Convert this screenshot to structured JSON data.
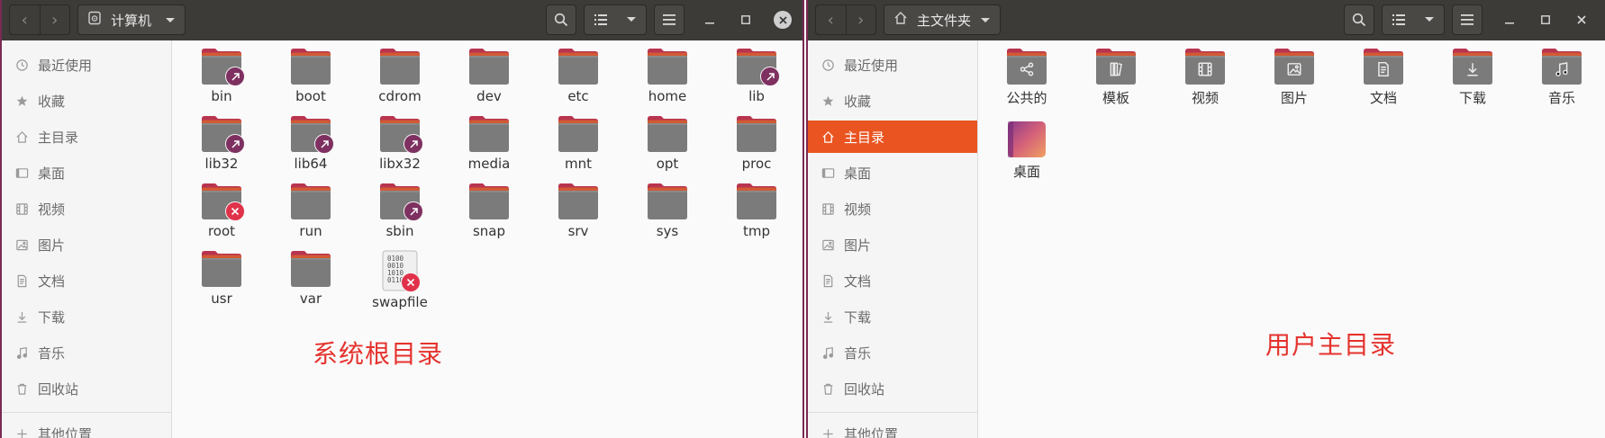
{
  "left_window": {
    "location": "计算机",
    "sidebar": {
      "items": [
        {
          "label": "最近使用",
          "icon": "clock-icon"
        },
        {
          "label": "收藏",
          "icon": "star-icon"
        },
        {
          "label": "主目录",
          "icon": "home-icon"
        },
        {
          "label": "桌面",
          "icon": "desktop-icon"
        },
        {
          "label": "视频",
          "icon": "video-icon"
        },
        {
          "label": "图片",
          "icon": "image-icon"
        },
        {
          "label": "文档",
          "icon": "document-icon"
        },
        {
          "label": "下载",
          "icon": "download-icon"
        },
        {
          "label": "音乐",
          "icon": "music-icon"
        },
        {
          "label": "回收站",
          "icon": "trash-icon"
        }
      ],
      "other": {
        "label": "其他位置",
        "icon": "plus-icon"
      }
    },
    "items": [
      {
        "name": "bin",
        "emblem": "link"
      },
      {
        "name": "boot",
        "emblem": ""
      },
      {
        "name": "cdrom",
        "emblem": ""
      },
      {
        "name": "dev",
        "emblem": ""
      },
      {
        "name": "etc",
        "emblem": ""
      },
      {
        "name": "home",
        "emblem": ""
      },
      {
        "name": "lib",
        "emblem": "link"
      },
      {
        "name": "lib32",
        "emblem": "link"
      },
      {
        "name": "lib64",
        "emblem": "link"
      },
      {
        "name": "libx32",
        "emblem": "link"
      },
      {
        "name": "media",
        "emblem": ""
      },
      {
        "name": "mnt",
        "emblem": ""
      },
      {
        "name": "opt",
        "emblem": ""
      },
      {
        "name": "proc",
        "emblem": ""
      },
      {
        "name": "root",
        "emblem": "noaccess"
      },
      {
        "name": "run",
        "emblem": ""
      },
      {
        "name": "sbin",
        "emblem": "link"
      },
      {
        "name": "snap",
        "emblem": ""
      },
      {
        "name": "srv",
        "emblem": ""
      },
      {
        "name": "sys",
        "emblem": ""
      },
      {
        "name": "tmp",
        "emblem": ""
      },
      {
        "name": "usr",
        "emblem": ""
      },
      {
        "name": "var",
        "emblem": ""
      },
      {
        "name": "swapfile",
        "emblem": "noaccess",
        "kind": "file",
        "file_text": [
          "0100",
          "0010",
          "1010",
          "0110"
        ]
      }
    ],
    "annotation": "系统根目录"
  },
  "right_window": {
    "location": "主文件夹",
    "sidebar": {
      "items": [
        {
          "label": "最近使用",
          "icon": "clock-icon"
        },
        {
          "label": "收藏",
          "icon": "star-icon"
        },
        {
          "label": "主目录",
          "icon": "home-icon",
          "active": true
        },
        {
          "label": "桌面",
          "icon": "desktop-icon"
        },
        {
          "label": "视频",
          "icon": "video-icon"
        },
        {
          "label": "图片",
          "icon": "image-icon"
        },
        {
          "label": "文档",
          "icon": "document-icon"
        },
        {
          "label": "下载",
          "icon": "download-icon"
        },
        {
          "label": "音乐",
          "icon": "music-icon"
        },
        {
          "label": "回收站",
          "icon": "trash-icon"
        }
      ],
      "other": {
        "label": "其他位置",
        "icon": "plus-icon"
      }
    },
    "items": [
      {
        "name": "公共的",
        "emblem": "share-icon"
      },
      {
        "name": "模板",
        "emblem": "template-icon"
      },
      {
        "name": "视频",
        "emblem": "video-icon"
      },
      {
        "name": "图片",
        "emblem": "image-icon"
      },
      {
        "name": "文档",
        "emblem": "document-icon"
      },
      {
        "name": "下载",
        "emblem": "download-icon"
      },
      {
        "name": "音乐",
        "emblem": "music-icon"
      },
      {
        "name": "桌面",
        "emblem": "desktop-folder",
        "kind": "desktop"
      }
    ],
    "annotation": "用户主目录"
  },
  "colors": {
    "accent": "#e95420",
    "folder_top": "#c4405a",
    "folder_body": "#7b7b7b",
    "annotation": "#e5322d",
    "headerbar": "#3d3b38"
  }
}
